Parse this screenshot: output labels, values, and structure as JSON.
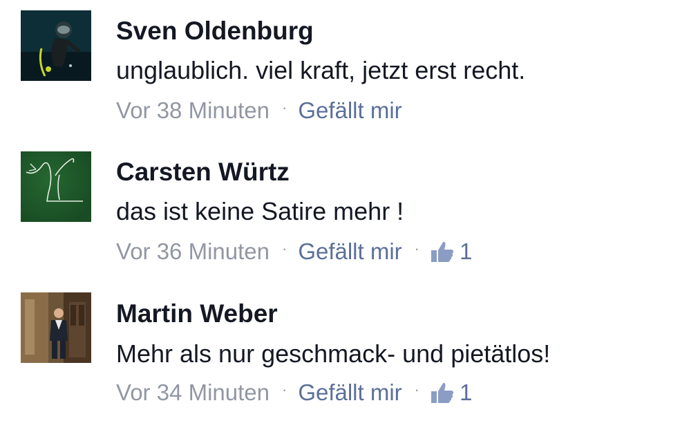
{
  "comments": [
    {
      "author": "Sven Oldenburg",
      "text": "unglaublich. viel kraft, jetzt erst recht.",
      "time": "Vor 38 Minuten",
      "like_label": "Gefällt mir",
      "likes": null,
      "avatar_icon": "scuba-diver-photo"
    },
    {
      "author": "Carsten Würtz",
      "text": "das ist keine Satire mehr !",
      "time": "Vor 36 Minuten",
      "like_label": "Gefällt mir",
      "likes": "1",
      "avatar_icon": "chalk-drawing-figure-photo"
    },
    {
      "author": "Martin Weber",
      "text": "Mehr als nur geschmack- und pietätlos!",
      "time": "Vor 34 Minuten",
      "like_label": "Gefällt mir",
      "likes": "1",
      "avatar_icon": "man-standing-doorway-photo"
    }
  ],
  "separator": "·",
  "colors": {
    "name": "#141823",
    "text": "#141823",
    "meta_gray": "#9197a3",
    "link_blue": "#5b7099",
    "thumb": "#8b9dc3"
  }
}
